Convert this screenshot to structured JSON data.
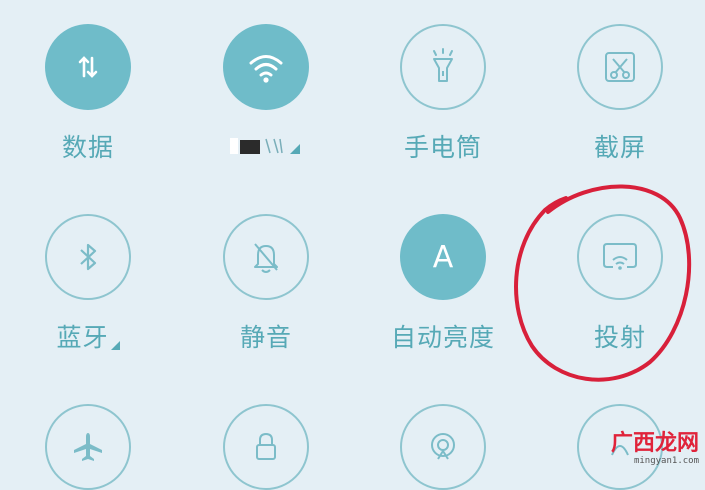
{
  "tiles": [
    {
      "id": "data",
      "label": "数据",
      "icon": "data-transfer-icon",
      "on": true
    },
    {
      "id": "wifi",
      "label": "",
      "icon": "wifi-icon",
      "on": true,
      "redacted": true
    },
    {
      "id": "flashlight",
      "label": "手电筒",
      "icon": "flashlight-icon",
      "on": false
    },
    {
      "id": "screenshot",
      "label": "截屏",
      "icon": "scissors-icon",
      "on": false
    },
    {
      "id": "bluetooth",
      "label": "蓝牙",
      "icon": "bluetooth-icon",
      "on": false
    },
    {
      "id": "silent",
      "label": "静音",
      "icon": "bell-off-icon",
      "on": false
    },
    {
      "id": "auto-brightness",
      "label": "自动亮度",
      "icon": "letter-a-icon",
      "on": true,
      "glyph": "A"
    },
    {
      "id": "cast",
      "label": "投射",
      "icon": "cast-screen-icon",
      "on": false
    },
    {
      "id": "airplane",
      "label": "",
      "icon": "airplane-icon",
      "on": false
    },
    {
      "id": "rotation-lock",
      "label": "",
      "icon": "lock-icon",
      "on": false
    },
    {
      "id": "hotspot",
      "label": "",
      "icon": "hotspot-icon",
      "on": false
    },
    {
      "id": "more",
      "label": "",
      "icon": "partial-icon",
      "on": false
    }
  ],
  "annotation": {
    "color": "#d8203a",
    "target": "cast"
  },
  "watermark": {
    "title": "广西龙网",
    "url": "mingyan1.com"
  },
  "colors": {
    "background": "#e4eff5",
    "accent": "#6fbcc9",
    "label": "#56a9b6",
    "outline": "#8ec5cf"
  }
}
